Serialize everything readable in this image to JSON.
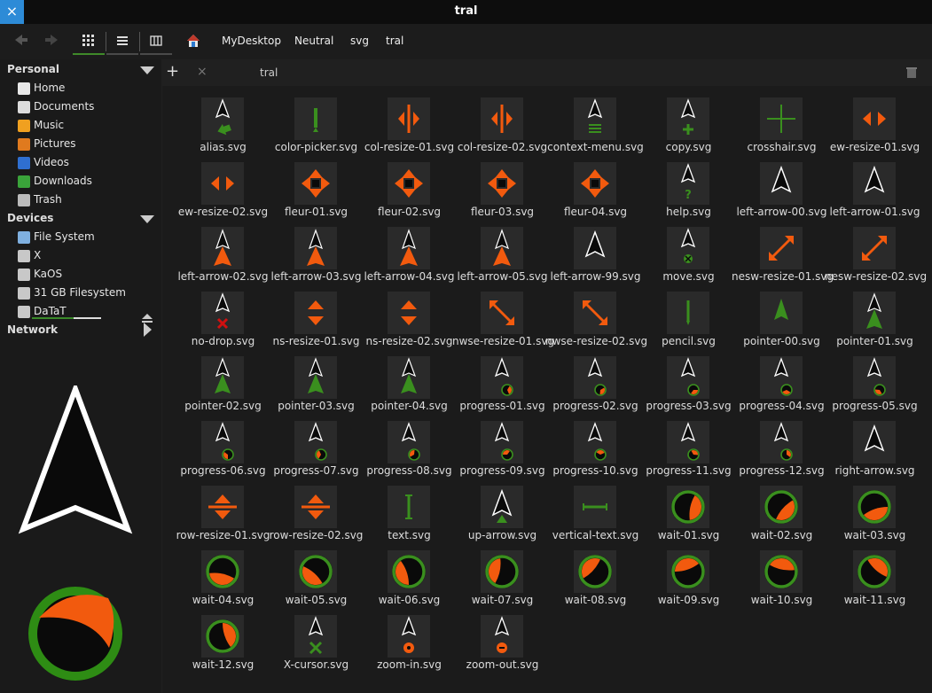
{
  "window": {
    "title": "tral",
    "close_glyph": "×"
  },
  "toolbar": {
    "back_icon": "back-arrow-icon",
    "forward_icon": "forward-arrow-icon",
    "view_icons": [
      "icon-view-icon",
      "list-view-icon",
      "column-view-icon"
    ],
    "breadcrumbs": [
      "MyDesktop",
      "Neutral",
      "svg",
      "tral"
    ]
  },
  "sidebar": {
    "sections": [
      {
        "title": "Personal",
        "items": [
          "Home",
          "Documents",
          "Music",
          "Pictures",
          "Videos",
          "Downloads",
          "Trash"
        ]
      },
      {
        "title": "Devices",
        "items": [
          "File System",
          "X",
          "KaOS",
          "31 GB Filesystem",
          "DaTaT"
        ]
      },
      {
        "title": "Network",
        "items": []
      }
    ],
    "datat_usage_fraction": 0.6
  },
  "tabbar": {
    "add_glyph": "+",
    "close_glyph": "×",
    "tab_label": "tral"
  },
  "files": [
    "alias.svg",
    "color-picker.svg",
    "col-resize-01.svg",
    "col-resize-02.svg",
    "context-menu.svg",
    "copy.svg",
    "crosshair.svg",
    "ew-resize-01.svg",
    "ew-resize-02.svg",
    "fleur-01.svg",
    "fleur-02.svg",
    "fleur-03.svg",
    "fleur-04.svg",
    "help.svg",
    "left-arrow-00.svg",
    "left-arrow-01.svg",
    "left-arrow-02.svg",
    "left-arrow-03.svg",
    "left-arrow-04.svg",
    "left-arrow-05.svg",
    "left-arrow-99.svg",
    "move.svg",
    "nesw-resize-01.svg",
    "nesw-resize-02.svg",
    "no-drop.svg",
    "ns-resize-01.svg",
    "ns-resize-02.svg",
    "nwse-resize-01.svg",
    "nwse-resize-02.svg",
    "pencil.svg",
    "pointer-00.svg",
    "pointer-01.svg",
    "pointer-02.svg",
    "pointer-03.svg",
    "pointer-04.svg",
    "progress-01.svg",
    "progress-02.svg",
    "progress-03.svg",
    "progress-04.svg",
    "progress-05.svg",
    "progress-06.svg",
    "progress-07.svg",
    "progress-08.svg",
    "progress-09.svg",
    "progress-10.svg",
    "progress-11.svg",
    "progress-12.svg",
    "right-arrow.svg",
    "row-resize-01.svg",
    "row-resize-02.svg",
    "text.svg",
    "up-arrow.svg",
    "vertical-text.svg",
    "wait-01.svg",
    "wait-02.svg",
    "wait-03.svg",
    "wait-04.svg",
    "wait-05.svg",
    "wait-06.svg",
    "wait-07.svg",
    "wait-08.svg",
    "wait-09.svg",
    "wait-10.svg",
    "wait-11.svg",
    "wait-12.svg",
    "X-cursor.svg",
    "zoom-in.svg",
    "zoom-out.svg"
  ],
  "colors": {
    "accent_orange": "#f25a0e",
    "accent_green": "#3a8f1e",
    "tile_bg": "#2a2a2a",
    "selection_blue": "#2d8bd7"
  }
}
